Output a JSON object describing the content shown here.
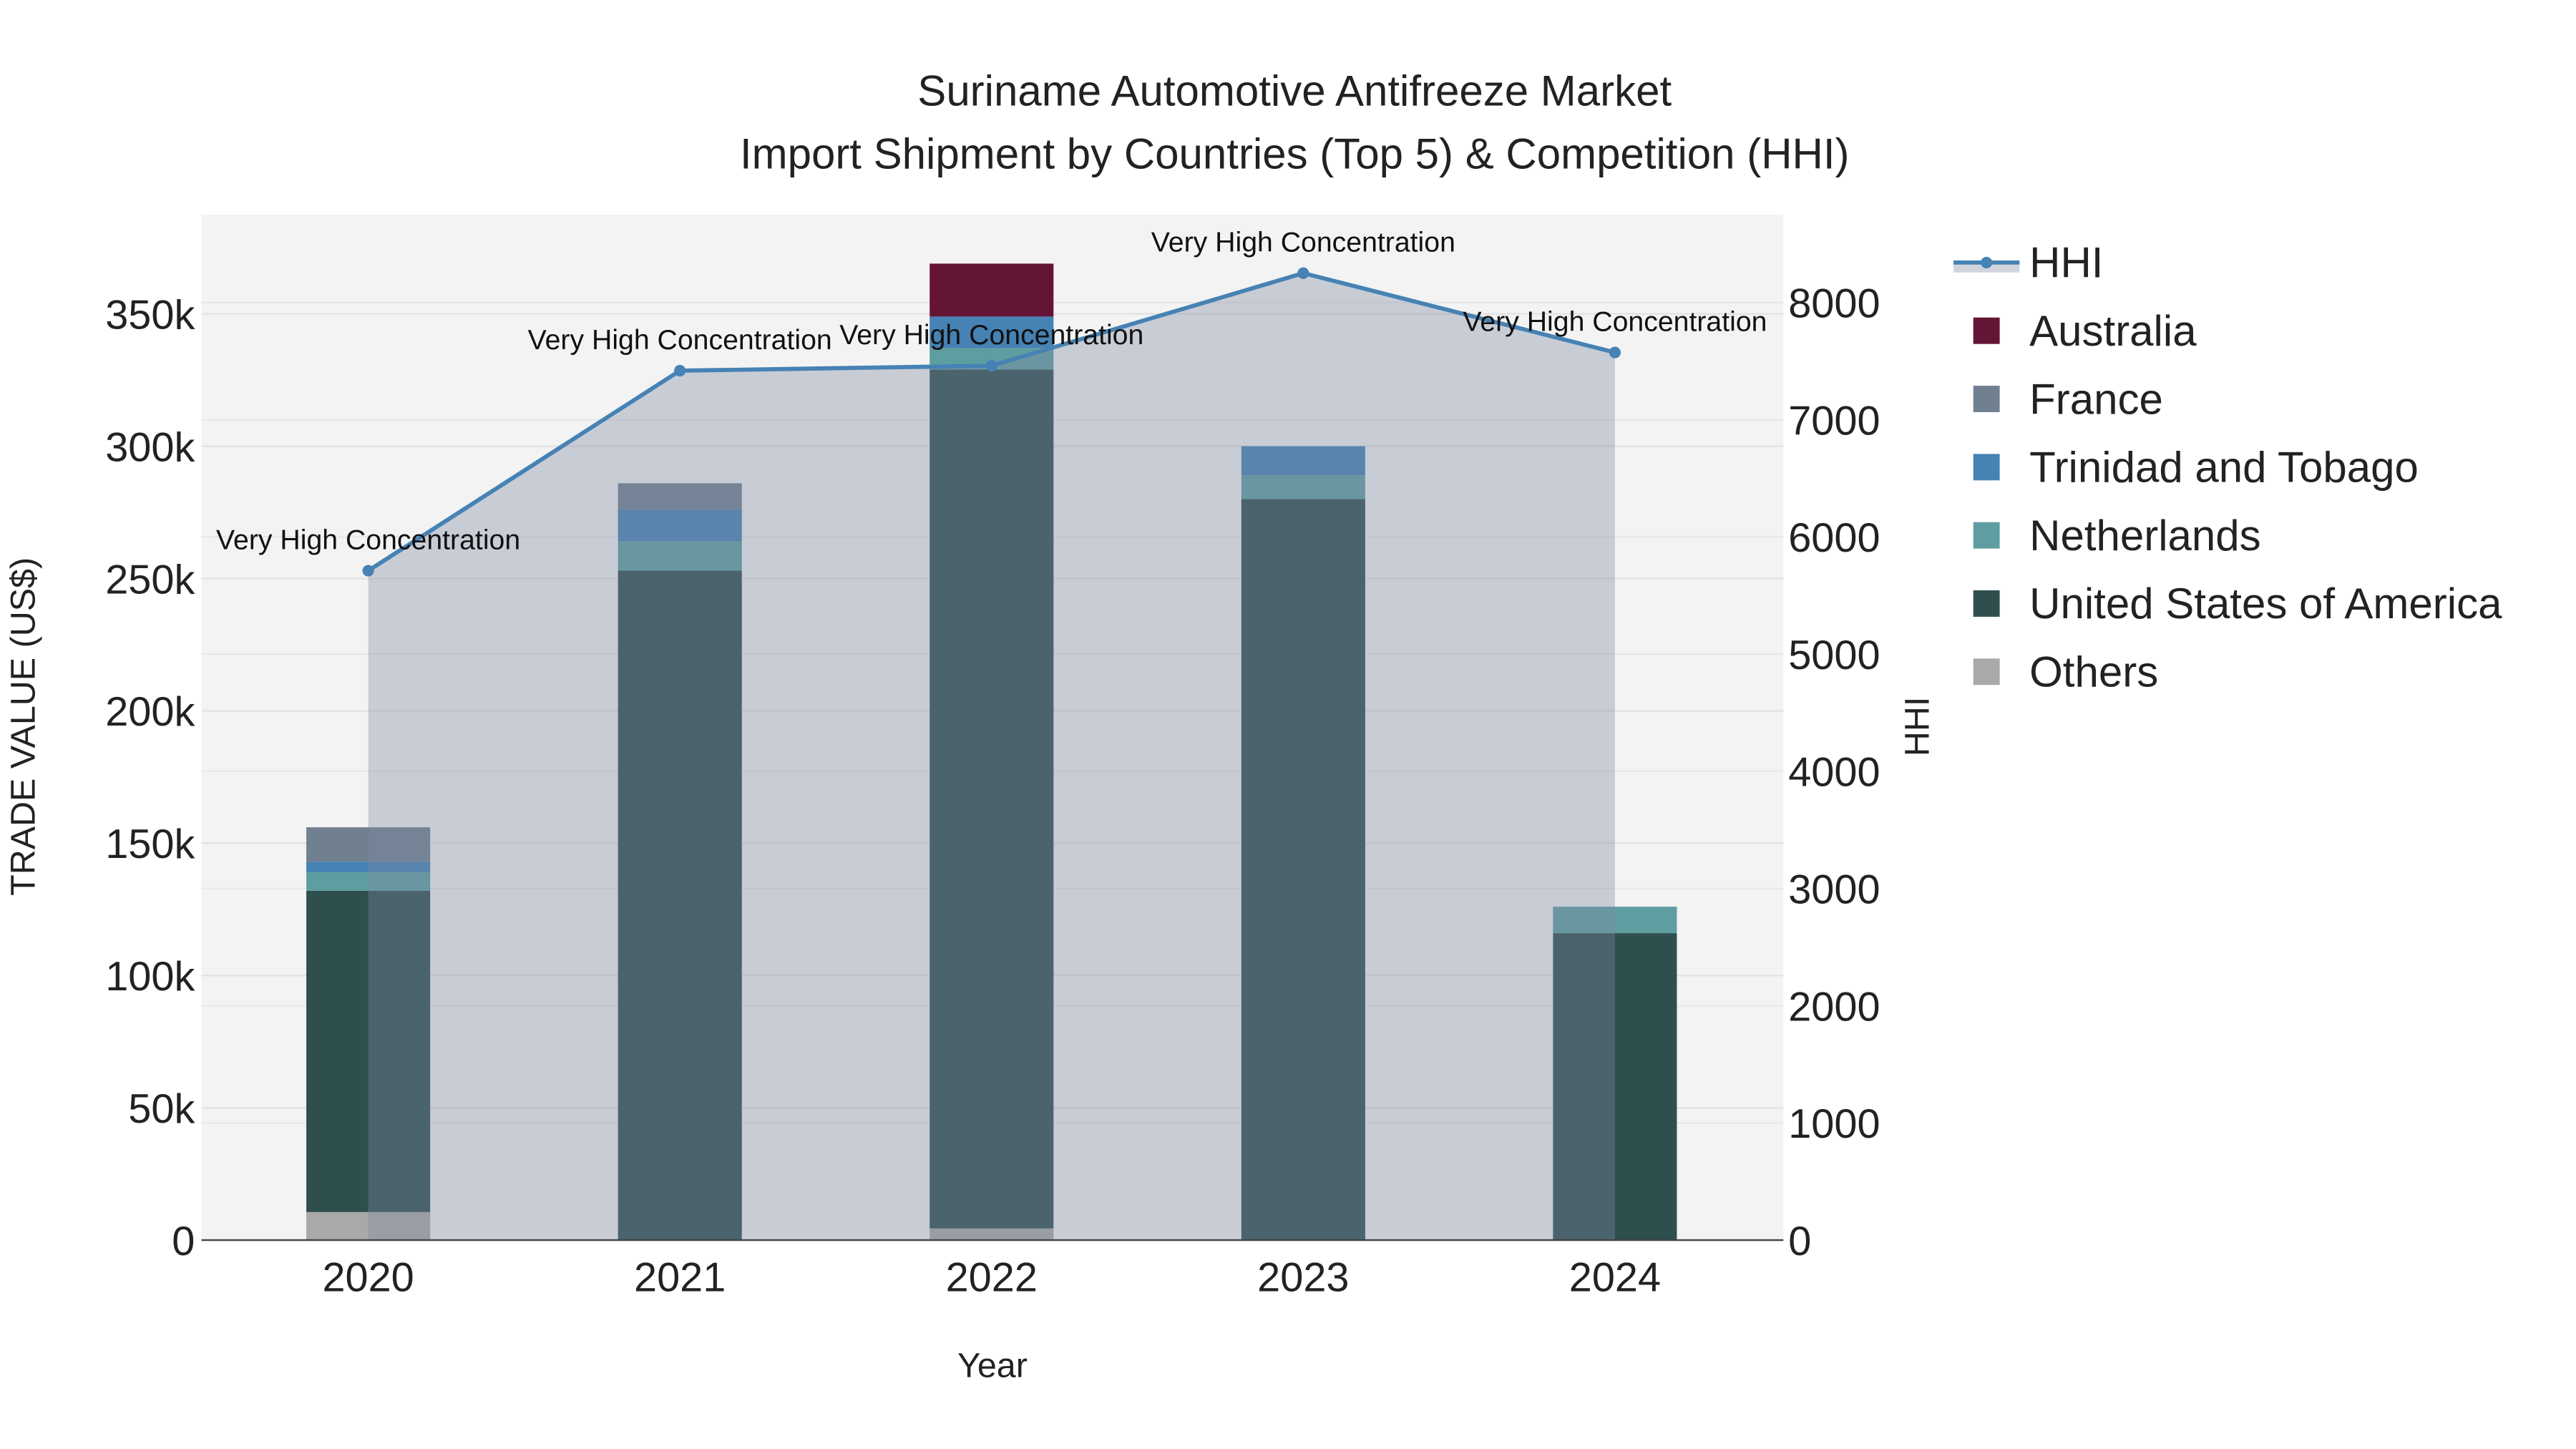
{
  "chart_data": {
    "type": "bar",
    "title": "Suriname Automotive Antifreeze Market",
    "subtitle": "Import Shipment by Countries (Top 5) & Competition (HHI)",
    "xlabel": "Year",
    "ylabel": "TRADE VALUE (US$)",
    "y2label": "HHI",
    "categories": [
      "2020",
      "2021",
      "2022",
      "2023",
      "2024"
    ],
    "ylim": [
      0,
      387500
    ],
    "y2lim": [
      0,
      8750
    ],
    "yticks": [
      0,
      50000,
      100000,
      150000,
      200000,
      250000,
      300000,
      350000
    ],
    "ytick_labels": [
      "0",
      "50k",
      "100k",
      "150k",
      "200k",
      "250k",
      "300k",
      "350k"
    ],
    "y2ticks": [
      0,
      1000,
      2000,
      3000,
      4000,
      5000,
      6000,
      7000,
      8000
    ],
    "y2tick_labels": [
      "0",
      "1000",
      "2000",
      "3000",
      "4000",
      "5000",
      "6000",
      "7000",
      "8000"
    ],
    "grid": true,
    "legend_position": "right",
    "series": [
      {
        "name": "Others",
        "color": "#A9A9A9",
        "values": [
          10600,
          0,
          4400,
          0,
          0
        ]
      },
      {
        "name": "United States of America",
        "color": "#2F4F4F",
        "values": [
          121400,
          253000,
          324600,
          280000,
          116000
        ]
      },
      {
        "name": "Netherlands",
        "color": "#5F9EA0",
        "values": [
          7000,
          11000,
          8000,
          9000,
          10000
        ]
      },
      {
        "name": "Trinidad and Tobago",
        "color": "#4682B4",
        "values": [
          4000,
          12000,
          12000,
          11000,
          0
        ]
      },
      {
        "name": "France",
        "color": "#708090",
        "values": [
          13000,
          10000,
          0,
          0,
          0
        ]
      },
      {
        "name": "Australia",
        "color": "#641536",
        "values": [
          0,
          0,
          20000,
          0,
          0
        ]
      }
    ],
    "hhi": {
      "name": "HHI",
      "color": "#4682B4",
      "values": [
        5712,
        7419,
        7461,
        8251,
        7574
      ]
    },
    "annotations": [
      "Very High Concentration",
      "Very High Concentration",
      "Very High Concentration",
      "Very High Concentration",
      "Very High Concentration"
    ],
    "legend_order": [
      "HHI",
      "Australia",
      "France",
      "Trinidad and Tobago",
      "Netherlands",
      "United States of America",
      "Others"
    ]
  }
}
